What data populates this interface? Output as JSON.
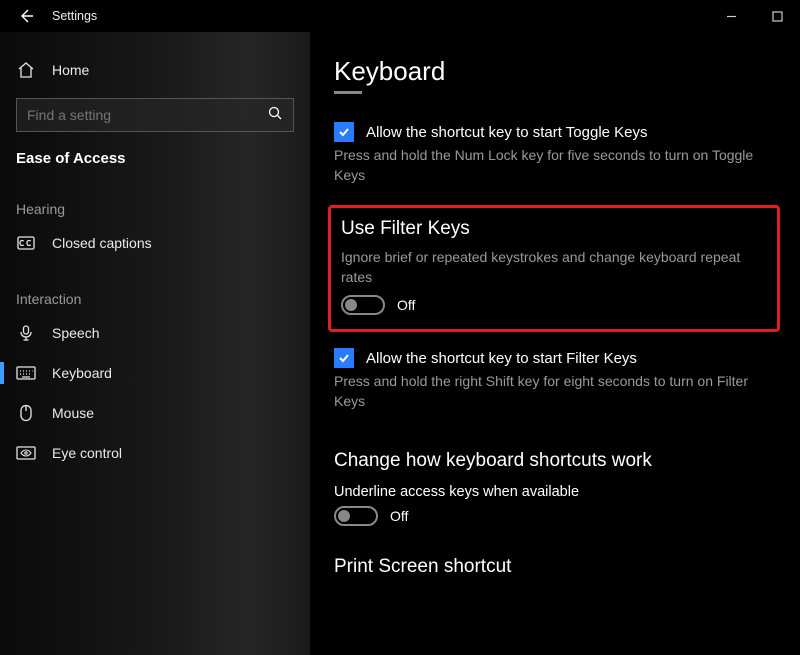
{
  "window": {
    "title": "Settings"
  },
  "sidebar": {
    "home": "Home",
    "search_placeholder": "Find a setting",
    "section": "Ease of Access",
    "groups": [
      {
        "label": "Hearing",
        "items": [
          {
            "id": "closed-captions",
            "label": "Closed captions"
          }
        ]
      },
      {
        "label": "Interaction",
        "items": [
          {
            "id": "speech",
            "label": "Speech"
          },
          {
            "id": "keyboard",
            "label": "Keyboard",
            "selected": true
          },
          {
            "id": "mouse",
            "label": "Mouse"
          },
          {
            "id": "eye-control",
            "label": "Eye control"
          }
        ]
      }
    ]
  },
  "main": {
    "title": "Keyboard",
    "toggle_keys": {
      "checkbox_label": "Allow the shortcut key to start Toggle Keys",
      "desc": "Press and hold the Num Lock key for five seconds to turn on Toggle Keys"
    },
    "filter_keys": {
      "heading": "Use Filter Keys",
      "desc": "Ignore brief or repeated keystrokes and change keyboard repeat rates",
      "toggle_state": "Off",
      "checkbox_label": "Allow the shortcut key to start Filter Keys",
      "sub_desc": "Press and hold the right Shift key for eight seconds to turn on Filter Keys"
    },
    "shortcuts": {
      "heading": "Change how keyboard shortcuts work",
      "underline_label": "Underline access keys when available",
      "toggle_state": "Off"
    },
    "printscreen": {
      "heading": "Print Screen shortcut"
    }
  }
}
